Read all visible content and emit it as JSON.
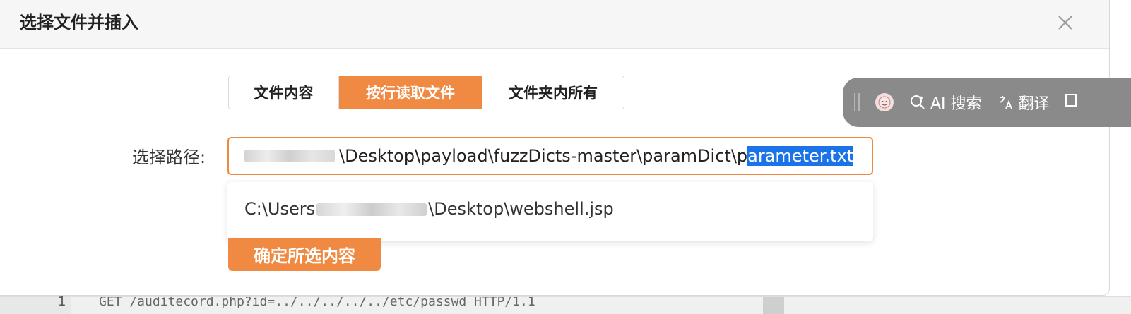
{
  "dialog": {
    "title": "选择文件并插入",
    "close_icon": "close-icon"
  },
  "tabs": [
    {
      "label": "文件内容",
      "active": false
    },
    {
      "label": "按行读取文件",
      "active": true
    },
    {
      "label": "文件夹内所有",
      "active": false
    }
  ],
  "path": {
    "label": "选择路径:",
    "value_prefix": "\\Desktop\\payload\\fuzzDicts-master\\paramDict\\p",
    "value_selected": "arameter.txt"
  },
  "suggestions": {
    "item_prefix": "C:\\Users",
    "item_suffix": "\\Desktop\\webshell.jsp"
  },
  "confirm_label": "确定所选内容",
  "ai_toolbar": {
    "search_label": "AI 搜索",
    "translate_label": "翻译"
  },
  "background_editor": {
    "line_number": "1",
    "code_text": "GET /auditecord.php?id=../../../../../etc/passwd HTTP/1.1"
  },
  "colors": {
    "accent": "#f08a43",
    "selection": "#1a73e8",
    "ai_toolbar_bg": "#8a8a8a"
  }
}
